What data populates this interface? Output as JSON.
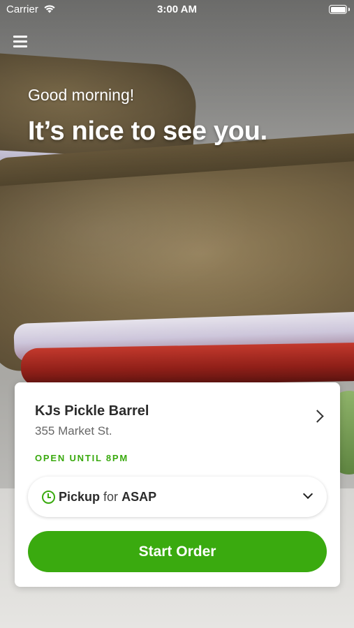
{
  "status_bar": {
    "carrier": "Carrier",
    "time": "3:00 AM"
  },
  "hero": {
    "greeting": "Good morning!",
    "headline": "It’s nice to see you."
  },
  "store": {
    "name": "KJs Pickle Barrel",
    "address": "355 Market St.",
    "hours_status": "OPEN UNTIL 8PM"
  },
  "order_type": {
    "mode": "Pickup",
    "for_label": "for",
    "when": "ASAP"
  },
  "actions": {
    "start_order_label": "Start Order"
  },
  "colors": {
    "accent": "#3aaa0f",
    "text_dark": "#2b2b2b",
    "text_muted": "#666666",
    "card_bg": "#ffffff"
  },
  "icons": {
    "menu": "hamburger-menu-icon",
    "wifi": "wifi-icon",
    "battery": "battery-icon",
    "clock": "clock-icon",
    "store_chevron": "chevron-right-icon",
    "dropdown": "chevron-down-icon"
  }
}
